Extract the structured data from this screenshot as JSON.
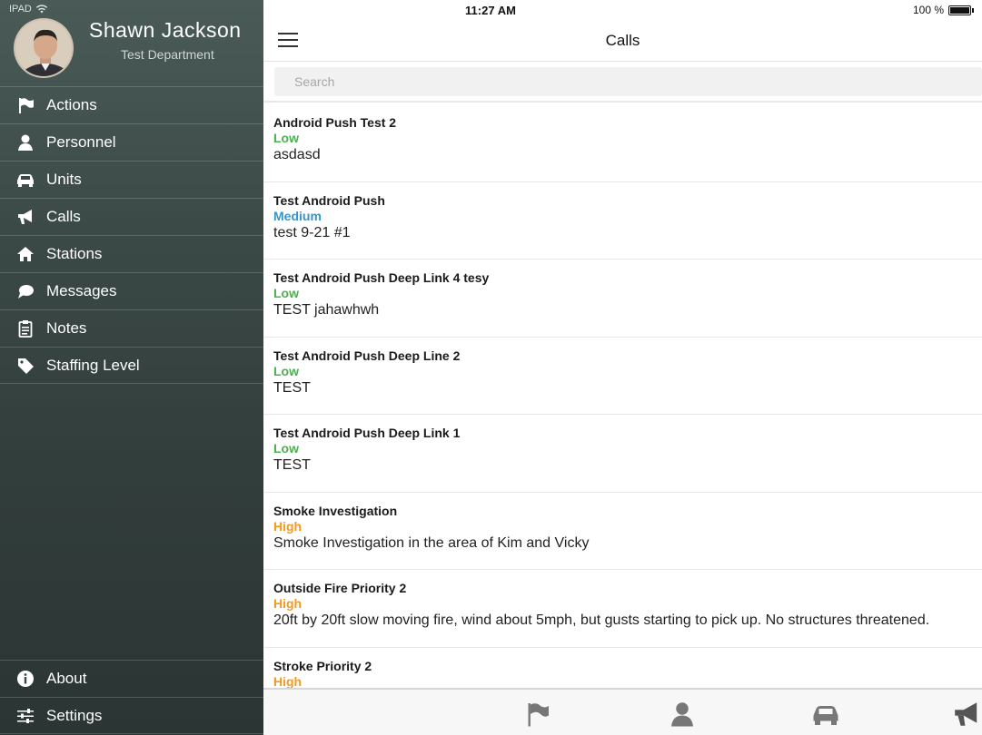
{
  "status_bar": {
    "carrier": "IPAD",
    "time": "11:27 AM",
    "battery": "100 %"
  },
  "profile": {
    "name": "Shawn Jackson",
    "department": "Test Department"
  },
  "sidebar": {
    "items": [
      {
        "label": "Actions",
        "icon": "flag-icon"
      },
      {
        "label": "Personnel",
        "icon": "person-icon"
      },
      {
        "label": "Units",
        "icon": "car-icon"
      },
      {
        "label": "Calls",
        "icon": "megaphone-icon"
      },
      {
        "label": "Stations",
        "icon": "home-icon"
      },
      {
        "label": "Messages",
        "icon": "chat-icon"
      },
      {
        "label": "Notes",
        "icon": "clipboard-icon"
      },
      {
        "label": "Staffing Level",
        "icon": "tag-icon"
      }
    ],
    "bottom_items": [
      {
        "label": "About",
        "icon": "info-icon"
      },
      {
        "label": "Settings",
        "icon": "sliders-icon"
      }
    ]
  },
  "header": {
    "title": "Calls"
  },
  "search": {
    "placeholder": "Search",
    "value": ""
  },
  "calls": [
    {
      "name": "Android Push Test 2",
      "priority": "Low",
      "nature": "asdasd"
    },
    {
      "name": "Test Android Push",
      "priority": "Medium",
      "nature": "test 9-21 #1"
    },
    {
      "name": "Test Android Push Deep Link 4 tesy",
      "priority": "Low",
      "nature": "TEST jahawhwh"
    },
    {
      "name": "Test Android Push Deep Line 2",
      "priority": "Low",
      "nature": "TEST"
    },
    {
      "name": "Test Android Push Deep Link 1",
      "priority": "Low",
      "nature": "TEST"
    },
    {
      "name": "Smoke Investigation",
      "priority": "High",
      "nature": "Smoke Investigation in the area of Kim and Vicky"
    },
    {
      "name": "Outside Fire Priority 2",
      "priority": "High",
      "nature": "20ft by 20ft slow moving fire, wind about 5mph, but gusts starting to pick up. No structures threatened."
    },
    {
      "name": "Stroke Priority 2",
      "priority": "High",
      "nature": ""
    }
  ],
  "tab_bar": {
    "tabs": [
      "flag-icon",
      "person-icon",
      "car-icon",
      "megaphone-icon"
    ]
  },
  "colors": {
    "low": "#4caf50",
    "medium": "#3a93c8",
    "high": "#f39a1e",
    "sidebar": "#3a4845"
  }
}
